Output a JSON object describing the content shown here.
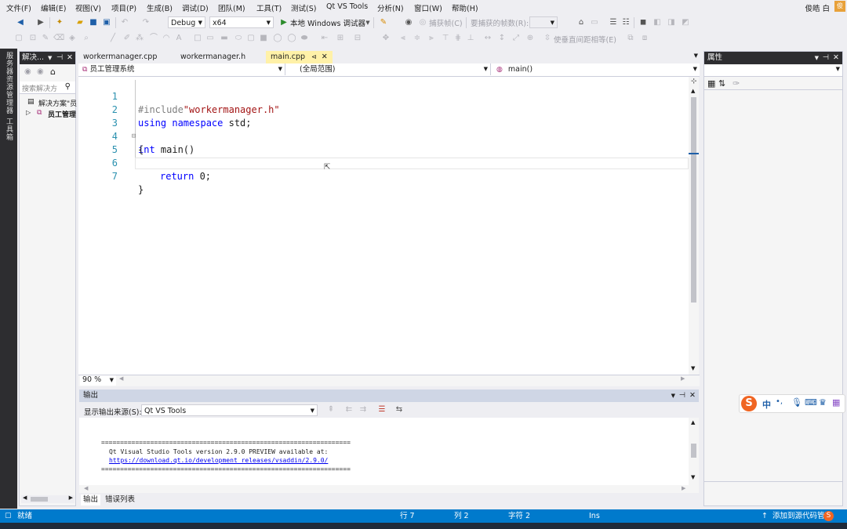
{
  "menu": [
    "文件(F)",
    "编辑(E)",
    "视图(V)",
    "项目(P)",
    "生成(B)",
    "调试(D)",
    "团队(M)",
    "工具(T)",
    "测试(S)",
    "Qt VS Tools",
    "分析(N)",
    "窗口(W)",
    "帮助(H)"
  ],
  "user": {
    "name": "俊皓 白",
    "avatar": "俊"
  },
  "toolbar": {
    "config": "Debug",
    "platform": "x64",
    "run_label": "本地 Windows 调试器",
    "capture_frame": "捕获帧(C)",
    "frames_to_capture": "要捕获的帧数(R):",
    "spacing": "使垂直间距相等(E)"
  },
  "left_strip_text": "服务器资源管理器 工具箱",
  "solution_explorer": {
    "title": "解决...",
    "search_placeholder": "搜索解决方",
    "solution": "解决方案\"员",
    "project": "员工管理"
  },
  "tabs": [
    {
      "label": "workermanager.cpp",
      "active": false
    },
    {
      "label": "workermanager.h",
      "active": false
    },
    {
      "label": "main.cpp",
      "active": true
    }
  ],
  "navbar": {
    "project": "员工管理系统",
    "scope": "(全局范围)",
    "member": "main()"
  },
  "code_lines": [
    {
      "n": "1",
      "text": "#include\"workermanager.h\""
    },
    {
      "n": "2",
      "text": "using namespace std;"
    },
    {
      "n": "3",
      "text": "int main()"
    },
    {
      "n": "4",
      "text": "{"
    },
    {
      "n": "5",
      "text": ""
    },
    {
      "n": "6",
      "text": "return 0;"
    },
    {
      "n": "7",
      "text": "}"
    }
  ],
  "zoom": "90 %",
  "output": {
    "title": "输出",
    "source_label": "显示输出来源(S):",
    "source": "Qt VS Tools",
    "lines": [
      "==================================================================",
      "Qt Visual Studio Tools version 2.9.0 PREVIEW available at:",
      "https://download.qt.io/development_releases/vsaddin/2.9.0/",
      "=================================================================="
    ],
    "tabs": [
      "输出",
      "错误列表"
    ]
  },
  "properties": {
    "title": "属性"
  },
  "status": {
    "ready": "就绪",
    "line": "行 7",
    "col": "列 2",
    "char": "字符 2",
    "mode": "Ins",
    "source_control": "添加到源代码管理"
  },
  "ime": {
    "mode": "中",
    "punct": "•,"
  },
  "colors": {
    "accent": "#007acc",
    "keyword": "#0000ff",
    "string": "#a31515",
    "active_tab": "#fff1a8"
  }
}
